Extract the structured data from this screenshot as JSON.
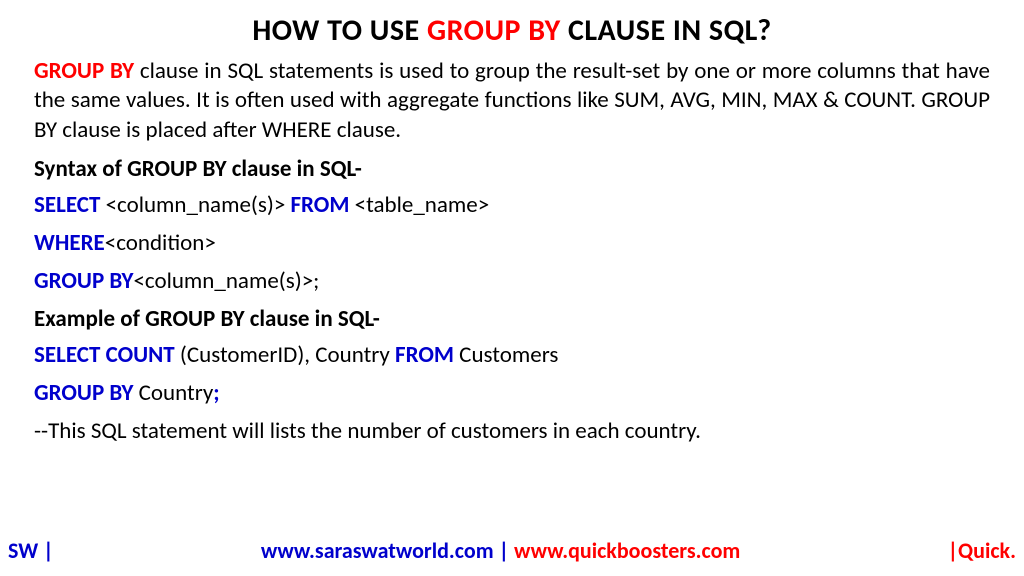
{
  "title": {
    "pre": "HOW TO USE ",
    "highlight": "GROUP BY",
    "post": " CLAUSE IN SQL?"
  },
  "intro": {
    "lead": "GROUP BY",
    "rest": " clause in SQL statements is used to group the result-set by one or more columns that have the same values. It is often used with aggregate functions like SUM, AVG, MIN, MAX & COUNT. GROUP BY clause is placed after WHERE clause."
  },
  "syntax": {
    "heading": "Syntax of GROUP BY clause in SQL-",
    "l1": {
      "kw1": "SELECT",
      "t1": " <column_name(s)> ",
      "kw2": "FROM",
      "t2": " <table_name>"
    },
    "l2": {
      "kw1": "WHERE",
      "t1": "<condition>"
    },
    "l3": {
      "kw1": "GROUP BY",
      "t1": "<column_name(s)>;"
    }
  },
  "example": {
    "heading": "Example of GROUP BY clause in SQL-",
    "l1": {
      "kw1": "SELECT COUNT",
      "t1": " (CustomerID), Country ",
      "kw2": "FROM",
      "t2": " Customers"
    },
    "l2": {
      "kw1": "GROUP BY",
      "t1": " Country",
      "kw2": ";"
    },
    "comment": "--This SQL statement will lists the number of customers in each country."
  },
  "footer": {
    "left": "SW |",
    "center_site1": "www.saraswatworld.com",
    "center_sep": " | ",
    "center_site2": "www.quickboosters.com",
    "right": "|Quick."
  }
}
